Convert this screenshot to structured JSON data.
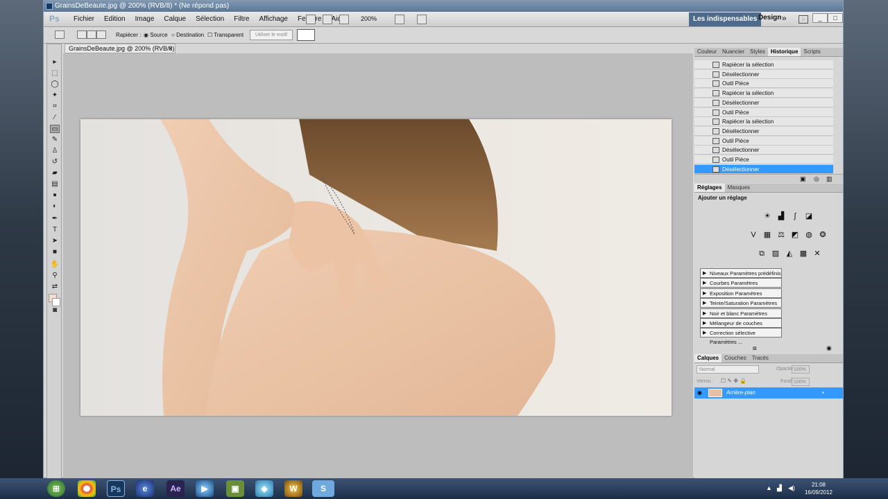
{
  "window": {
    "title": "GrainsDeBeaute.jpg @ 200% (RVB/8) * (Ne répond pas)"
  },
  "app": {
    "logo": "Ps",
    "menus": [
      "Fichier",
      "Edition",
      "Image",
      "Calque",
      "Sélection",
      "Filtre",
      "Affichage",
      "Fenêtre",
      "Aide"
    ],
    "zoom": "200%",
    "workspace": "Les indispensables",
    "design": "Design",
    "more": "»"
  },
  "options": {
    "rapiecer": "Rapiécer :",
    "source": "Source",
    "destination": "Destination",
    "transparent": "Transparent",
    "use_pattern": "Utiliser le motif"
  },
  "document": {
    "tab": "GrainsDeBeaute.jpg @ 200% (RVB/8) *",
    "close": "×"
  },
  "history_panel": {
    "tabs": [
      "Couleur",
      "Nuancier",
      "Styles",
      "Historique",
      "Scripts"
    ],
    "active_tab": "Historique",
    "items": [
      "Rapiécer la sélection",
      "Désélectionner",
      "Outil Pièce",
      "Rapiécer la sélection",
      "Désélectionner",
      "Outil Pièce",
      "Rapiécer la sélection",
      "Désélectionner",
      "Outil Pièce",
      "Désélectionner",
      "Outil Pièce",
      "Désélectionner"
    ]
  },
  "adjust_panel": {
    "tabs": [
      "Réglages",
      "Masques"
    ],
    "title": "Ajouter un réglage",
    "presets": [
      "Niveaux Paramètres prédéfinis",
      "Courbes Paramètres prédéfinis",
      "Exposition Paramètres prédéfinis",
      "Teinte/Saturation Paramètres pr...",
      "Noir et blanc Paramètres prédéfi...",
      "Mélangeur de couches Paramètr...",
      "Correction sélective Paramètres ..."
    ]
  },
  "layers_panel": {
    "tabs": [
      "Calques",
      "Couches",
      "Tracés"
    ],
    "blend": "Normal",
    "opacity_label": "Opacité :",
    "opacity": "100%",
    "lock_label": "Verrou :",
    "fill_label": "Fond :",
    "fill": "100%",
    "layer_name": "Arrière-plan"
  },
  "taskbar": {
    "time": "21:08",
    "date": "16/09/2012"
  }
}
